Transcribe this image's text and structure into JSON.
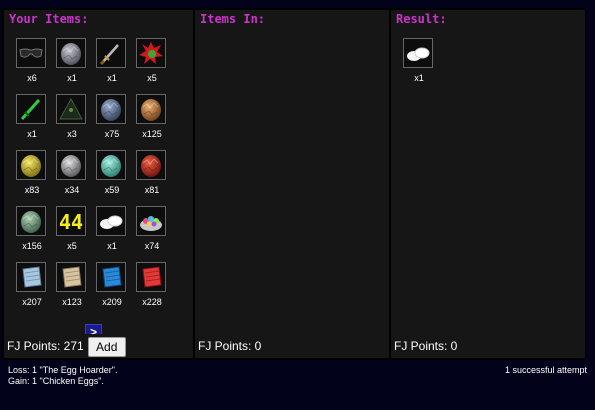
{
  "panels": {
    "your_items": {
      "title": "Your Items:",
      "points_label": "FJ Points: 271",
      "add_label": "Add",
      "next_label": ">"
    },
    "items_in": {
      "title": "Items In:",
      "points_label": "FJ Points: 0"
    },
    "result": {
      "title": "Result:",
      "points_label": "FJ Points: 0"
    }
  },
  "inventory": [
    {
      "icon": "sunglasses-icon",
      "qty": "x6"
    },
    {
      "icon": "gray-egg-icon",
      "qty": "x1"
    },
    {
      "icon": "sword-icon",
      "qty": "x1"
    },
    {
      "icon": "red-splat-icon",
      "qty": "x5"
    },
    {
      "icon": "green-sword-icon",
      "qty": "x1"
    },
    {
      "icon": "dark-pyramid-icon",
      "qty": "x3"
    },
    {
      "icon": "blue-gray-egg-icon",
      "qty": "x75"
    },
    {
      "icon": "orange-egg-icon",
      "qty": "x125"
    },
    {
      "icon": "yellow-egg-icon",
      "qty": "x83"
    },
    {
      "icon": "silver-egg-icon",
      "qty": "x34"
    },
    {
      "icon": "teal-egg-icon",
      "qty": "x59"
    },
    {
      "icon": "red-egg-icon",
      "qty": "x81"
    },
    {
      "icon": "green-gray-egg-icon",
      "qty": "x156"
    },
    {
      "icon": "number-44-icon",
      "qty": "x5"
    },
    {
      "icon": "chicken-eggs-icon",
      "qty": "x1"
    },
    {
      "icon": "egg-nest-icon",
      "qty": "x74"
    },
    {
      "icon": "light-blue-fabric-icon",
      "qty": "x207"
    },
    {
      "icon": "tan-fabric-icon",
      "qty": "x123"
    },
    {
      "icon": "blue-fabric-icon",
      "qty": "x209"
    },
    {
      "icon": "red-fabric-icon",
      "qty": "x228"
    }
  ],
  "result_items": [
    {
      "icon": "chicken-eggs-icon",
      "qty": "x1"
    }
  ],
  "log": {
    "loss": "Loss: 1 \"The Egg Hoarder\".",
    "gain": "Gain: 1 \"Chicken Eggs\".",
    "attempts": "1 successful attempt"
  },
  "colors": {
    "background": "#02021a",
    "panel": "#161616",
    "header_text": "#cc33cc"
  }
}
